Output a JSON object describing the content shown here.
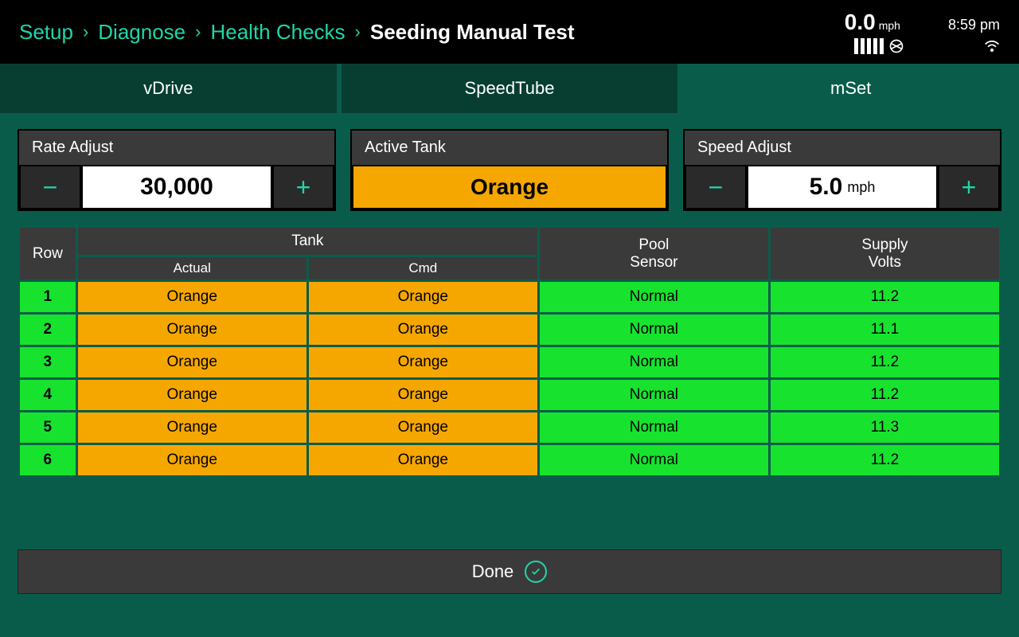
{
  "breadcrumb": {
    "items": [
      "Setup",
      "Diagnose",
      "Health Checks"
    ],
    "current": "Seeding Manual Test"
  },
  "status": {
    "speed": "0.0",
    "speed_unit": "mph",
    "time": "8:59 pm"
  },
  "tabs": [
    {
      "label": "vDrive",
      "active": false
    },
    {
      "label": "SpeedTube",
      "active": false
    },
    {
      "label": "mSet",
      "active": true
    }
  ],
  "controls": {
    "rate": {
      "label": "Rate Adjust",
      "value": "30,000"
    },
    "tank": {
      "label": "Active Tank",
      "value": "Orange"
    },
    "speed": {
      "label": "Speed Adjust",
      "value": "5.0",
      "unit": "mph"
    }
  },
  "table": {
    "headers": {
      "row": "Row",
      "tank": "Tank",
      "actual": "Actual",
      "cmd": "Cmd",
      "pool": "Pool\nSensor",
      "volts": "Supply\nVolts"
    },
    "rows": [
      {
        "n": "1",
        "actual": "Orange",
        "cmd": "Orange",
        "pool": "Normal",
        "volts": "11.2"
      },
      {
        "n": "2",
        "actual": "Orange",
        "cmd": "Orange",
        "pool": "Normal",
        "volts": "11.1"
      },
      {
        "n": "3",
        "actual": "Orange",
        "cmd": "Orange",
        "pool": "Normal",
        "volts": "11.2"
      },
      {
        "n": "4",
        "actual": "Orange",
        "cmd": "Orange",
        "pool": "Normal",
        "volts": "11.2"
      },
      {
        "n": "5",
        "actual": "Orange",
        "cmd": "Orange",
        "pool": "Normal",
        "volts": "11.3"
      },
      {
        "n": "6",
        "actual": "Orange",
        "cmd": "Orange",
        "pool": "Normal",
        "volts": "11.2"
      }
    ]
  },
  "done_label": "Done"
}
